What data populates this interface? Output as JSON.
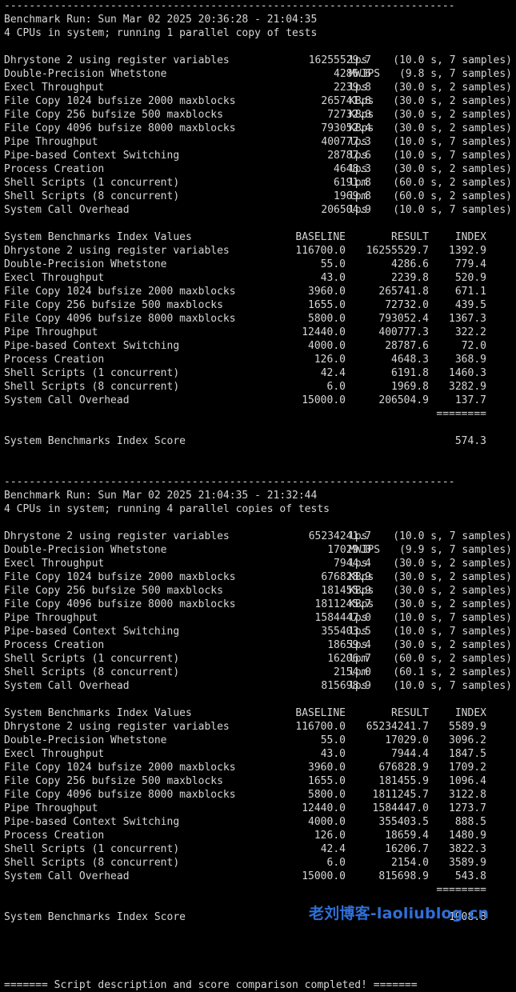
{
  "watermark": "老刘博客-laoliublog.cn",
  "footer": "======= Script description and score comparison completed! =======",
  "runs": [
    {
      "separator": "------------------------------------------------------------------------",
      "header": "Benchmark Run: Sun Mar 02 2025 20:36:28 - 21:04:35",
      "cpus": "4 CPUs in system; running 1 parallel copy of tests",
      "results": [
        {
          "name": "Dhrystone 2 using register variables",
          "value": "16255529.7",
          "unit": "lps",
          "detail": "(10.0 s, 7 samples)"
        },
        {
          "name": "Double-Precision Whetstone",
          "value": "4286.6",
          "unit": "MWIPS",
          "detail": "(9.8 s, 7 samples)"
        },
        {
          "name": "Execl Throughput",
          "value": "2239.8",
          "unit": "lps",
          "detail": "(30.0 s, 2 samples)"
        },
        {
          "name": "File Copy 1024 bufsize 2000 maxblocks",
          "value": "265741.8",
          "unit": "KBps",
          "detail": "(30.0 s, 2 samples)"
        },
        {
          "name": "File Copy 256 bufsize 500 maxblocks",
          "value": "72732.0",
          "unit": "KBps",
          "detail": "(30.0 s, 2 samples)"
        },
        {
          "name": "File Copy 4096 bufsize 8000 maxblocks",
          "value": "793052.4",
          "unit": "KBps",
          "detail": "(30.0 s, 2 samples)"
        },
        {
          "name": "Pipe Throughput",
          "value": "400777.3",
          "unit": "lps",
          "detail": "(10.0 s, 7 samples)"
        },
        {
          "name": "Pipe-based Context Switching",
          "value": "28787.6",
          "unit": "lps",
          "detail": "(10.0 s, 7 samples)"
        },
        {
          "name": "Process Creation",
          "value": "4648.3",
          "unit": "lps",
          "detail": "(30.0 s, 2 samples)"
        },
        {
          "name": "Shell Scripts (1 concurrent)",
          "value": "6191.8",
          "unit": "lpm",
          "detail": "(60.0 s, 2 samples)"
        },
        {
          "name": "Shell Scripts (8 concurrent)",
          "value": "1969.8",
          "unit": "lpm",
          "detail": "(60.0 s, 2 samples)"
        },
        {
          "name": "System Call Overhead",
          "value": "206504.9",
          "unit": "lps",
          "detail": "(10.0 s, 7 samples)"
        }
      ],
      "index_header": {
        "title": "System Benchmarks Index Values",
        "baseline": "BASELINE",
        "result": "RESULT",
        "index": "INDEX"
      },
      "index_rows": [
        {
          "name": "Dhrystone 2 using register variables",
          "baseline": "116700.0",
          "result": "16255529.7",
          "index": "1392.9"
        },
        {
          "name": "Double-Precision Whetstone",
          "baseline": "55.0",
          "result": "4286.6",
          "index": "779.4"
        },
        {
          "name": "Execl Throughput",
          "baseline": "43.0",
          "result": "2239.8",
          "index": "520.9"
        },
        {
          "name": "File Copy 1024 bufsize 2000 maxblocks",
          "baseline": "3960.0",
          "result": "265741.8",
          "index": "671.1"
        },
        {
          "name": "File Copy 256 bufsize 500 maxblocks",
          "baseline": "1655.0",
          "result": "72732.0",
          "index": "439.5"
        },
        {
          "name": "File Copy 4096 bufsize 8000 maxblocks",
          "baseline": "5800.0",
          "result": "793052.4",
          "index": "1367.3"
        },
        {
          "name": "Pipe Throughput",
          "baseline": "12440.0",
          "result": "400777.3",
          "index": "322.2"
        },
        {
          "name": "Pipe-based Context Switching",
          "baseline": "4000.0",
          "result": "28787.6",
          "index": "72.0"
        },
        {
          "name": "Process Creation",
          "baseline": "126.0",
          "result": "4648.3",
          "index": "368.9"
        },
        {
          "name": "Shell Scripts (1 concurrent)",
          "baseline": "42.4",
          "result": "6191.8",
          "index": "1460.3"
        },
        {
          "name": "Shell Scripts (8 concurrent)",
          "baseline": "6.0",
          "result": "1969.8",
          "index": "3282.9"
        },
        {
          "name": "System Call Overhead",
          "baseline": "15000.0",
          "result": "206504.9",
          "index": "137.7"
        }
      ],
      "divider": "========",
      "score_label": "System Benchmarks Index Score",
      "score": "574.3"
    },
    {
      "separator": "------------------------------------------------------------------------",
      "header": "Benchmark Run: Sun Mar 02 2025 21:04:35 - 21:32:44",
      "cpus": "4 CPUs in system; running 4 parallel copies of tests",
      "results": [
        {
          "name": "Dhrystone 2 using register variables",
          "value": "65234241.7",
          "unit": "lps",
          "detail": "(10.0 s, 7 samples)"
        },
        {
          "name": "Double-Precision Whetstone",
          "value": "17029.0",
          "unit": "MWIPS",
          "detail": "(9.9 s, 7 samples)"
        },
        {
          "name": "Execl Throughput",
          "value": "7944.4",
          "unit": "lps",
          "detail": "(30.0 s, 2 samples)"
        },
        {
          "name": "File Copy 1024 bufsize 2000 maxblocks",
          "value": "676828.9",
          "unit": "KBps",
          "detail": "(30.0 s, 2 samples)"
        },
        {
          "name": "File Copy 256 bufsize 500 maxblocks",
          "value": "181455.9",
          "unit": "KBps",
          "detail": "(30.0 s, 2 samples)"
        },
        {
          "name": "File Copy 4096 bufsize 8000 maxblocks",
          "value": "1811245.7",
          "unit": "KBps",
          "detail": "(30.0 s, 2 samples)"
        },
        {
          "name": "Pipe Throughput",
          "value": "1584447.0",
          "unit": "lps",
          "detail": "(10.0 s, 7 samples)"
        },
        {
          "name": "Pipe-based Context Switching",
          "value": "355403.5",
          "unit": "lps",
          "detail": "(10.0 s, 7 samples)"
        },
        {
          "name": "Process Creation",
          "value": "18659.4",
          "unit": "lps",
          "detail": "(30.0 s, 2 samples)"
        },
        {
          "name": "Shell Scripts (1 concurrent)",
          "value": "16206.7",
          "unit": "lpm",
          "detail": "(60.0 s, 2 samples)"
        },
        {
          "name": "Shell Scripts (8 concurrent)",
          "value": "2154.0",
          "unit": "lpm",
          "detail": "(60.1 s, 2 samples)"
        },
        {
          "name": "System Call Overhead",
          "value": "815698.9",
          "unit": "lps",
          "detail": "(10.0 s, 7 samples)"
        }
      ],
      "index_header": {
        "title": "System Benchmarks Index Values",
        "baseline": "BASELINE",
        "result": "RESULT",
        "index": "INDEX"
      },
      "index_rows": [
        {
          "name": "Dhrystone 2 using register variables",
          "baseline": "116700.0",
          "result": "65234241.7",
          "index": "5589.9"
        },
        {
          "name": "Double-Precision Whetstone",
          "baseline": "55.0",
          "result": "17029.0",
          "index": "3096.2"
        },
        {
          "name": "Execl Throughput",
          "baseline": "43.0",
          "result": "7944.4",
          "index": "1847.5"
        },
        {
          "name": "File Copy 1024 bufsize 2000 maxblocks",
          "baseline": "3960.0",
          "result": "676828.9",
          "index": "1709.2"
        },
        {
          "name": "File Copy 256 bufsize 500 maxblocks",
          "baseline": "1655.0",
          "result": "181455.9",
          "index": "1096.4"
        },
        {
          "name": "File Copy 4096 bufsize 8000 maxblocks",
          "baseline": "5800.0",
          "result": "1811245.7",
          "index": "3122.8"
        },
        {
          "name": "Pipe Throughput",
          "baseline": "12440.0",
          "result": "1584447.0",
          "index": "1273.7"
        },
        {
          "name": "Pipe-based Context Switching",
          "baseline": "4000.0",
          "result": "355403.5",
          "index": "888.5"
        },
        {
          "name": "Process Creation",
          "baseline": "126.0",
          "result": "18659.4",
          "index": "1480.9"
        },
        {
          "name": "Shell Scripts (1 concurrent)",
          "baseline": "42.4",
          "result": "16206.7",
          "index": "3822.3"
        },
        {
          "name": "Shell Scripts (8 concurrent)",
          "baseline": "6.0",
          "result": "2154.0",
          "index": "3589.9"
        },
        {
          "name": "System Call Overhead",
          "baseline": "15000.0",
          "result": "815698.9",
          "index": "543.8"
        }
      ],
      "divider": "========",
      "score_label": "System Benchmarks Index Score",
      "score": "1908.8"
    }
  ]
}
